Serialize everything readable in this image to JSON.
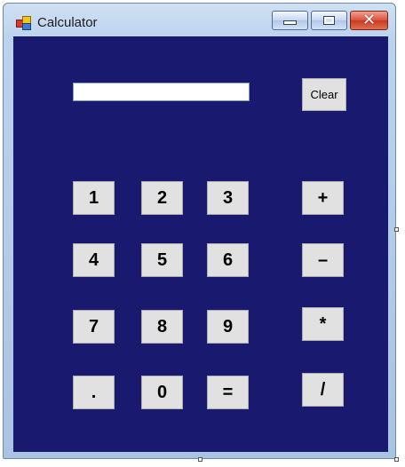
{
  "window": {
    "title": "Calculator",
    "controls": {
      "minimize": "minimize-icon",
      "maximize": "maximize-icon",
      "close": "close-icon"
    }
  },
  "colors": {
    "client_background": "#191970",
    "button_face": "#e1e1e1"
  },
  "display": {
    "value": ""
  },
  "buttons": {
    "clear": "Clear",
    "one": "1",
    "two": "2",
    "three": "3",
    "four": "4",
    "five": "5",
    "six": "6",
    "seven": "7",
    "eight": "8",
    "nine": "9",
    "dot": ".",
    "zero": "0",
    "equals": "=",
    "plus": "+",
    "minus": "–",
    "multiply": "*",
    "divide": "/"
  }
}
